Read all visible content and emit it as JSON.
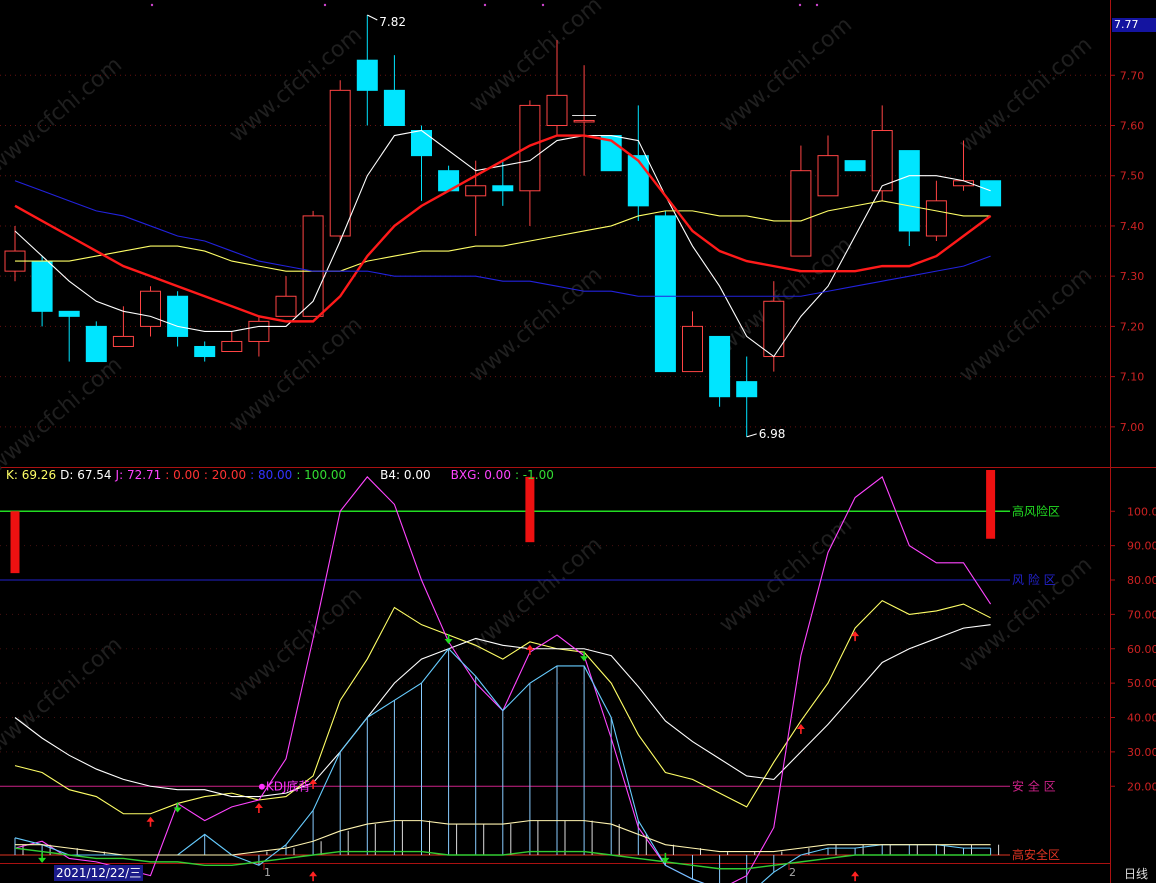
{
  "chart_data": [
    {
      "type": "candlestick",
      "title": "",
      "period_label": "日线",
      "y_ticks": [
        "7.00",
        "7.10",
        "7.20",
        "7.30",
        "7.40",
        "7.50",
        "7.60",
        "7.70"
      ],
      "ylim": [
        6.93,
        7.82
      ],
      "last_price_label": "7.77",
      "high_label": "7.82",
      "low_label": "6.98",
      "candles": [
        {
          "o": 7.31,
          "h": 7.4,
          "l": 7.29,
          "c": 7.35
        },
        {
          "o": 7.33,
          "h": 7.34,
          "l": 7.2,
          "c": 7.23
        },
        {
          "o": 7.23,
          "h": 7.23,
          "l": 7.13,
          "c": 7.22
        },
        {
          "o": 7.2,
          "h": 7.21,
          "l": 7.13,
          "c": 7.13
        },
        {
          "o": 7.16,
          "h": 7.24,
          "l": 7.16,
          "c": 7.18
        },
        {
          "o": 7.2,
          "h": 7.28,
          "l": 7.18,
          "c": 7.27
        },
        {
          "o": 7.26,
          "h": 7.27,
          "l": 7.16,
          "c": 7.18
        },
        {
          "o": 7.16,
          "h": 7.17,
          "l": 7.13,
          "c": 7.14
        },
        {
          "o": 7.15,
          "h": 7.19,
          "l": 7.15,
          "c": 7.17
        },
        {
          "o": 7.17,
          "h": 7.22,
          "l": 7.14,
          "c": 7.21
        },
        {
          "o": 7.22,
          "h": 7.3,
          "l": 7.22,
          "c": 7.26
        },
        {
          "o": 7.22,
          "h": 7.43,
          "l": 7.22,
          "c": 7.42
        },
        {
          "o": 7.38,
          "h": 7.69,
          "l": 7.37,
          "c": 7.67
        },
        {
          "o": 7.73,
          "h": 7.82,
          "l": 7.6,
          "c": 7.67
        },
        {
          "o": 7.67,
          "h": 7.74,
          "l": 7.6,
          "c": 7.6
        },
        {
          "o": 7.59,
          "h": 7.6,
          "l": 7.45,
          "c": 7.54
        },
        {
          "o": 7.51,
          "h": 7.52,
          "l": 7.47,
          "c": 7.47
        },
        {
          "o": 7.46,
          "h": 7.53,
          "l": 7.38,
          "c": 7.48
        },
        {
          "o": 7.48,
          "h": 7.53,
          "l": 7.44,
          "c": 7.47
        },
        {
          "o": 7.47,
          "h": 7.65,
          "l": 7.4,
          "c": 7.64
        },
        {
          "o": 7.6,
          "h": 7.77,
          "l": 7.58,
          "c": 7.66
        },
        {
          "o": 7.61,
          "h": 7.72,
          "l": 7.5,
          "c": 7.61
        },
        {
          "o": 7.58,
          "h": 7.58,
          "l": 7.51,
          "c": 7.51
        },
        {
          "o": 7.54,
          "h": 7.64,
          "l": 7.41,
          "c": 7.44
        },
        {
          "o": 7.42,
          "h": 7.43,
          "l": 7.11,
          "c": 7.11
        },
        {
          "o": 7.11,
          "h": 7.23,
          "l": 7.11,
          "c": 7.2
        },
        {
          "o": 7.18,
          "h": 7.18,
          "l": 7.04,
          "c": 7.06
        },
        {
          "o": 7.09,
          "h": 7.14,
          "l": 6.98,
          "c": 7.06
        },
        {
          "o": 7.14,
          "h": 7.29,
          "l": 7.11,
          "c": 7.25
        },
        {
          "o": 7.34,
          "h": 7.56,
          "l": 7.34,
          "c": 7.51
        },
        {
          "o": 7.46,
          "h": 7.58,
          "l": 7.46,
          "c": 7.54
        },
        {
          "o": 7.53,
          "h": 7.53,
          "l": 7.51,
          "c": 7.51
        },
        {
          "o": 7.47,
          "h": 7.64,
          "l": 7.45,
          "c": 7.59
        },
        {
          "o": 7.55,
          "h": 7.55,
          "l": 7.36,
          "c": 7.39
        },
        {
          "o": 7.38,
          "h": 7.49,
          "l": 7.37,
          "c": 7.45
        },
        {
          "o": 7.48,
          "h": 7.57,
          "l": 7.47,
          "c": 7.49
        },
        {
          "o": 7.49,
          "h": 7.49,
          "l": 7.44,
          "c": 7.44
        }
      ],
      "ma_series": [
        {
          "color": "#ffffff",
          "values": [
            7.39,
            7.34,
            7.29,
            7.25,
            7.23,
            7.22,
            7.2,
            7.19,
            7.19,
            7.2,
            7.2,
            7.25,
            7.37,
            7.5,
            7.58,
            7.59,
            7.55,
            7.51,
            7.52,
            7.53,
            7.57,
            7.58,
            7.58,
            7.57,
            7.46,
            7.36,
            7.28,
            7.18,
            7.14,
            7.22,
            7.28,
            7.38,
            7.48,
            7.5,
            7.5,
            7.49,
            7.47
          ]
        },
        {
          "color": "#ffff66",
          "values": [
            7.33,
            7.33,
            7.33,
            7.34,
            7.35,
            7.36,
            7.36,
            7.35,
            7.33,
            7.32,
            7.31,
            7.31,
            7.31,
            7.33,
            7.34,
            7.35,
            7.35,
            7.36,
            7.36,
            7.37,
            7.38,
            7.39,
            7.4,
            7.42,
            7.43,
            7.43,
            7.42,
            7.42,
            7.41,
            7.41,
            7.43,
            7.44,
            7.45,
            7.44,
            7.43,
            7.42,
            7.42
          ]
        },
        {
          "color": "#ff1a1a",
          "width": 2.4,
          "values": [
            7.44,
            7.41,
            7.38,
            7.35,
            7.32,
            7.3,
            7.28,
            7.26,
            7.24,
            7.22,
            7.21,
            7.21,
            7.26,
            7.34,
            7.4,
            7.44,
            7.47,
            7.5,
            7.53,
            7.56,
            7.58,
            7.58,
            7.57,
            7.53,
            7.46,
            7.39,
            7.35,
            7.33,
            7.32,
            7.31,
            7.31,
            7.31,
            7.32,
            7.32,
            7.34,
            7.38,
            7.42
          ]
        },
        {
          "color": "#2222dd",
          "values": [
            7.49,
            7.47,
            7.45,
            7.43,
            7.42,
            7.4,
            7.38,
            7.37,
            7.35,
            7.33,
            7.32,
            7.31,
            7.31,
            7.31,
            7.3,
            7.3,
            7.3,
            7.3,
            7.29,
            7.29,
            7.28,
            7.27,
            7.27,
            7.26,
            7.26,
            7.26,
            7.26,
            7.26,
            7.26,
            7.26,
            7.27,
            7.28,
            7.29,
            7.3,
            7.31,
            7.32,
            7.34
          ]
        }
      ]
    },
    {
      "type": "line",
      "title": "",
      "y_ticks": [
        "20.00",
        "30.00",
        "40.00",
        "50.00",
        "60.00",
        "70.00",
        "80.00",
        "90.00",
        "100.00"
      ],
      "ylim": [
        0,
        112
      ],
      "legend": [
        {
          "text": "K: 69.26",
          "color": "#ffff66"
        },
        {
          "text": "D: 67.54",
          "color": "#ffffff"
        },
        {
          "text": "J: 72.71",
          "color": "#ff44ff"
        },
        {
          "text": ": 0.00",
          "color": "#ff3333"
        },
        {
          "text": ": 20.00",
          "color": "#ff3333"
        },
        {
          "text": ": 80.00",
          "color": "#3333ff"
        },
        {
          "text": ": 100.00",
          "color": "#33dd33"
        },
        {
          "text": "B4: 0.00",
          "color": "#ffffff"
        },
        {
          "text": "BXG: 0.00",
          "color": "#ff44ff"
        },
        {
          "text": ": -1.00",
          "color": "#33dd33"
        }
      ],
      "reference_lines": [
        {
          "value": 100,
          "color": "#22dd22",
          "label": "高风险区"
        },
        {
          "value": 80,
          "color": "#2222cc",
          "label": "风 险 区"
        },
        {
          "value": 20,
          "color": "#cc2288",
          "label": "安 全 区"
        },
        {
          "value": 0,
          "color": "#dd3322",
          "label": "高安全区"
        }
      ],
      "annotations": [
        {
          "text": "KDJ底背",
          "color": "#ff33ff"
        }
      ],
      "series": [
        {
          "color": "#ffff66",
          "values": [
            26,
            24,
            19,
            17,
            12,
            12,
            15,
            17,
            18,
            16,
            17,
            23,
            45,
            57,
            72,
            67,
            64,
            61,
            57,
            62,
            60,
            59,
            50,
            35,
            24,
            22,
            18,
            14,
            27,
            39,
            50,
            66,
            74,
            70,
            71,
            73,
            69
          ]
        },
        {
          "color": "#ffffff",
          "values": [
            40,
            34,
            29,
            25,
            22,
            20,
            19,
            19,
            17,
            17,
            18,
            21,
            30,
            40,
            50,
            57,
            60,
            63,
            61,
            60,
            60,
            60,
            58,
            49,
            39,
            33,
            28,
            23,
            22,
            30,
            38,
            47,
            56,
            60,
            63,
            66,
            67
          ]
        },
        {
          "color": "#ff44ff",
          "values": [
            2,
            4,
            -1,
            -2,
            -4,
            -6,
            15,
            10,
            14,
            16,
            28,
            63,
            100,
            110,
            102,
            80,
            62,
            50,
            42,
            59,
            64,
            58,
            34,
            8,
            -3,
            -7,
            -10,
            -6,
            8,
            58,
            88,
            104,
            110,
            90,
            85,
            85,
            73
          ]
        },
        {
          "color": "#66ccff",
          "values": [
            5,
            3,
            0,
            0,
            0,
            0,
            0,
            6,
            0,
            -3,
            3,
            13,
            30,
            40,
            45,
            50,
            60,
            52,
            42,
            50,
            55,
            55,
            40,
            10,
            -3,
            -7,
            -10,
            -12,
            -5,
            0,
            2,
            2,
            3,
            3,
            3,
            2,
            2
          ]
        },
        {
          "color": "#fff4b0",
          "values": [
            3,
            3,
            2,
            1,
            0,
            0,
            0,
            0,
            0,
            1,
            2,
            4,
            7,
            9,
            10,
            10,
            9,
            9,
            9,
            10,
            10,
            10,
            9,
            6,
            3,
            2,
            1,
            1,
            1,
            2,
            3,
            3,
            3,
            3,
            3,
            3,
            3
          ]
        }
      ],
      "bars": [
        {
          "index": 0,
          "from": 100,
          "to": 82
        },
        {
          "index": 19,
          "from": 110,
          "to": 91
        },
        {
          "index": 36,
          "from": 112,
          "to": 92
        }
      ],
      "up_arrows": [
        5,
        9,
        11,
        19,
        29,
        31
      ],
      "down_arrows": [
        6,
        16,
        21
      ],
      "bottom_up_arrows": [
        11,
        31
      ],
      "bottom_down_arrows": [
        1,
        24
      ]
    }
  ],
  "footer": {
    "date": "2021/12/22/三",
    "tick_1": "1",
    "tick_2": "2"
  },
  "watermark": "www.cfchi.com"
}
